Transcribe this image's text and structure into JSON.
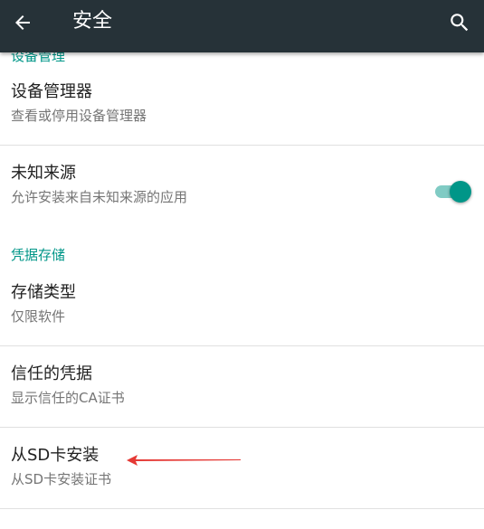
{
  "appbar": {
    "title": "安全",
    "back_icon": "arrow-back-icon",
    "search_icon": "search-icon",
    "background": "#263238"
  },
  "sections": {
    "device_admin_header": "设备管理",
    "credential_storage_header": "凭据存储"
  },
  "items": {
    "device_admins": {
      "title": "设备管理器",
      "summary": "查看或停用设备管理器"
    },
    "unknown_sources": {
      "title": "未知来源",
      "summary": "允许安装来自未知来源的应用",
      "toggle_on": true
    },
    "storage_type": {
      "title": "存储类型",
      "summary": "仅限软件"
    },
    "trusted_credentials": {
      "title": "信任的凭据",
      "summary": "显示信任的CA证书"
    },
    "install_from_sd": {
      "title": "从SD卡安装",
      "summary": "从SD卡安装证书"
    }
  },
  "colors": {
    "accent": "#009688",
    "accent_track": "#80cbc4",
    "annotation_arrow": "#e53935"
  }
}
